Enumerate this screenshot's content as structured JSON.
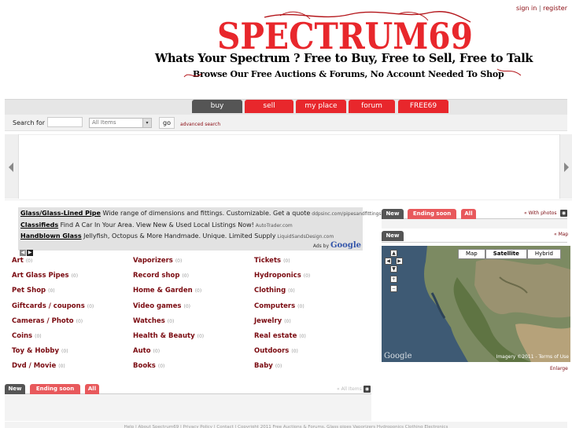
{
  "header": {
    "signin_label": "sign in",
    "separator": "|",
    "register_label": "register",
    "logo_text": "SPECTRUM69",
    "tagline": "Whats Your Spectrum ? Free to Buy, Free to Sell, Free to Talk",
    "subtagline": "Browse Our Free Auctions & Forums, No Account Needed To Shop"
  },
  "nav": {
    "tabs": [
      {
        "label": "buy",
        "active": true
      },
      {
        "label": "sell"
      },
      {
        "label": "my place"
      },
      {
        "label": "forum"
      },
      {
        "label": "FREE69"
      }
    ]
  },
  "search": {
    "label": "Search for :",
    "input_value": "",
    "category_selected": "All Items",
    "go_label": "go",
    "advanced_label": "advanced search"
  },
  "ads": {
    "items": [
      {
        "title": "Glass/Glass-Lined Pipe",
        "text": " Wide range of dimensions and fittings. Customizable. Get a quote",
        "url": " ddpsinc.com/pipesandfittings"
      },
      {
        "title": "Classifieds",
        "text": " Find A Car In Your Area. View New & Used Local Listings Now!",
        "url": " AutoTrader.com"
      },
      {
        "title": "Handblown Glass",
        "text": " Jellyfish, Octopus & More Handmade. Unique. Limited Supply",
        "url": " LiquidSandsDesign.com"
      }
    ],
    "ads_by": "Ads by",
    "ads_brand": "Google"
  },
  "categories": [
    {
      "name": "Art",
      "count": "(0)"
    },
    {
      "name": "Vaporizers",
      "count": "(0)"
    },
    {
      "name": "Tickets",
      "count": "(0)"
    },
    {
      "name": "Art Glass Pipes",
      "count": "(0)"
    },
    {
      "name": "Record shop",
      "count": "(0)"
    },
    {
      "name": "Hydroponics",
      "count": "(0)"
    },
    {
      "name": "Pet Shop",
      "count": "(0)"
    },
    {
      "name": "Home & Garden",
      "count": "(0)"
    },
    {
      "name": "Clothing",
      "count": "(0)"
    },
    {
      "name": "Giftcards / coupons",
      "count": "(0)"
    },
    {
      "name": "Video games",
      "count": "(0)"
    },
    {
      "name": "Computers",
      "count": "(0)"
    },
    {
      "name": "Cameras / Photo",
      "count": "(0)"
    },
    {
      "name": "Watches",
      "count": "(0)"
    },
    {
      "name": "Jewelry",
      "count": "(0)"
    },
    {
      "name": "Coins",
      "count": "(0)"
    },
    {
      "name": "Health & Beauty",
      "count": "(0)"
    },
    {
      "name": "Real estate",
      "count": "(0)"
    },
    {
      "name": "Toy & Hobby",
      "count": "(0)"
    },
    {
      "name": "Auto",
      "count": "(0)"
    },
    {
      "name": "Outdoors",
      "count": "(0)"
    },
    {
      "name": "Dvd / Movie",
      "count": "(0)"
    },
    {
      "name": "Books",
      "count": "(0)"
    },
    {
      "name": "Baby",
      "count": "(0)"
    }
  ],
  "listing_tabs": {
    "new_label": "New",
    "ending_label": "Ending soon",
    "all_label": "All",
    "with_photos": "« With photos",
    "all_items": "« All Items"
  },
  "map": {
    "new_label": "New",
    "map_link": "« Map",
    "type_map": "Map",
    "type_satellite": "Satellite",
    "type_hybrid": "Hybrid",
    "google": "Google",
    "copyright": "Imagery ©2011 - Terms of Use",
    "enlarge": "Enlarge"
  },
  "footer": {
    "text": "Help | About Spectrum69 | Privacy Policy | Contact | Copyright 2011 Free Auctions & Forums, Glass pipes Vaporizers Hydroponics Clothing Electronics"
  },
  "colors": {
    "brand_red": "#e8272c",
    "dark_tab": "#555555",
    "link_maroon": "#7a0a10"
  }
}
